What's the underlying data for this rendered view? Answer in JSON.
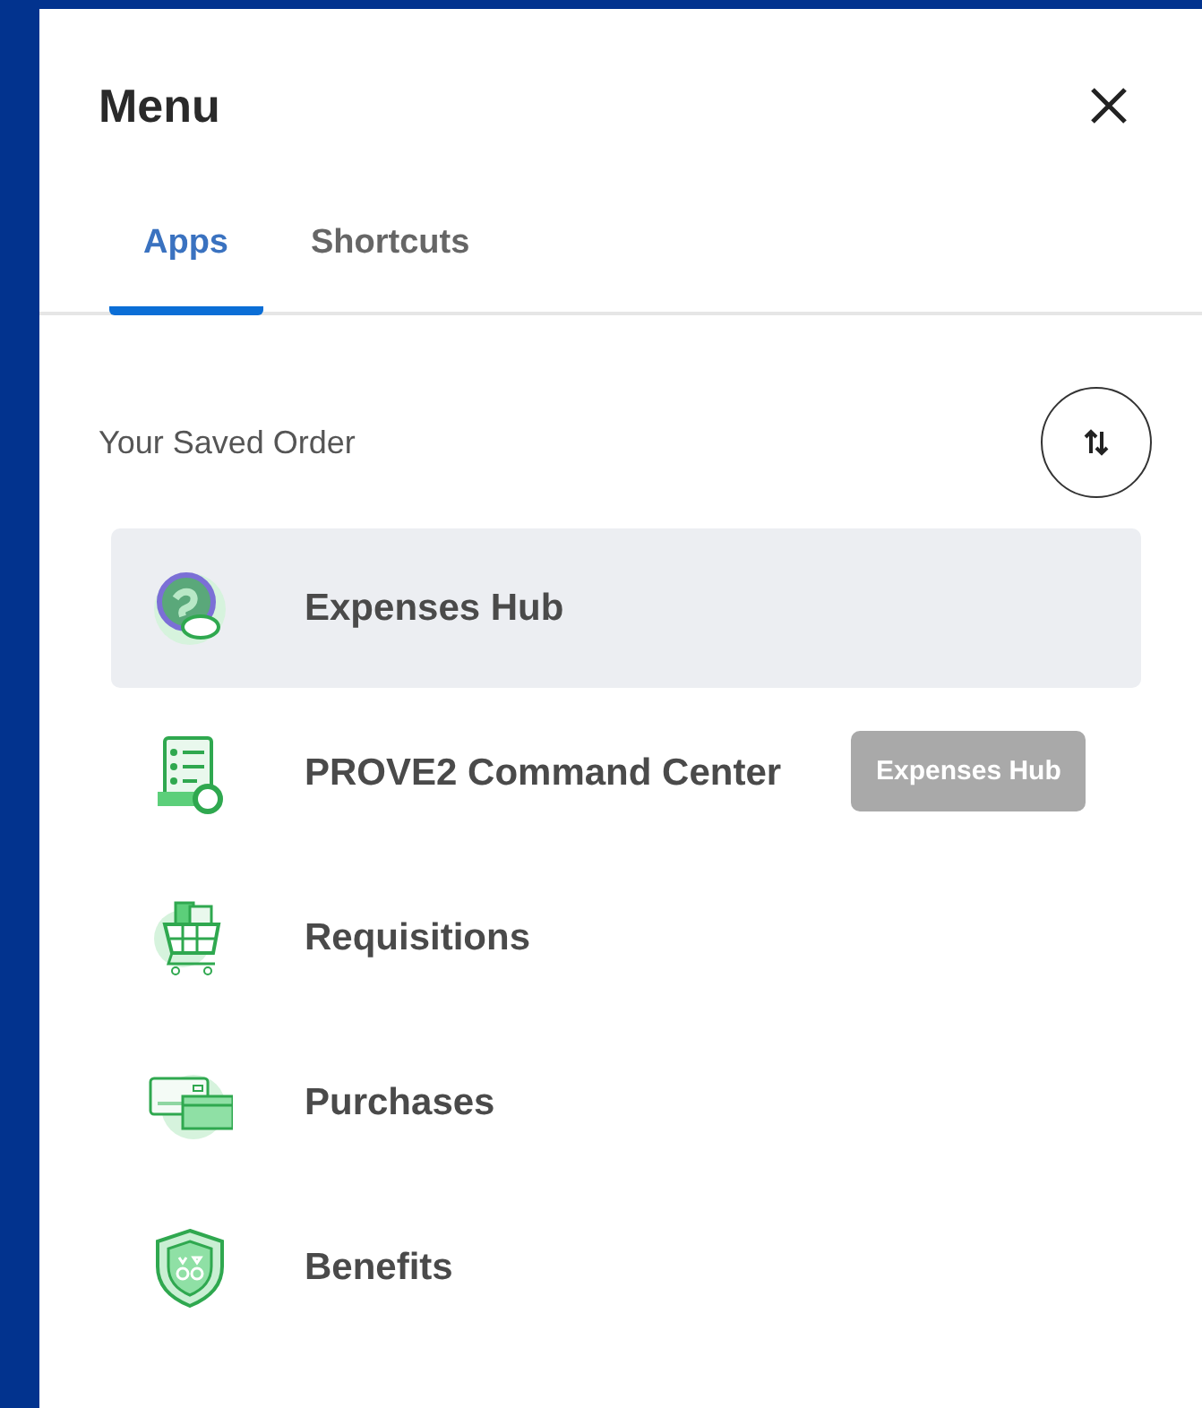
{
  "panel": {
    "title": "Menu"
  },
  "tabs": [
    {
      "label": "Apps",
      "selected": true
    },
    {
      "label": "Shortcuts",
      "selected": false
    }
  ],
  "section": {
    "label": "Your Saved Order"
  },
  "apps": [
    {
      "label": "Expenses Hub",
      "selected": true
    },
    {
      "label": "PROVE2 Command Center",
      "selected": false
    },
    {
      "label": "Requisitions",
      "selected": false
    },
    {
      "label": "Purchases",
      "selected": false
    },
    {
      "label": "Benefits",
      "selected": false
    }
  ],
  "tooltip": {
    "text": "Expenses Hub"
  }
}
